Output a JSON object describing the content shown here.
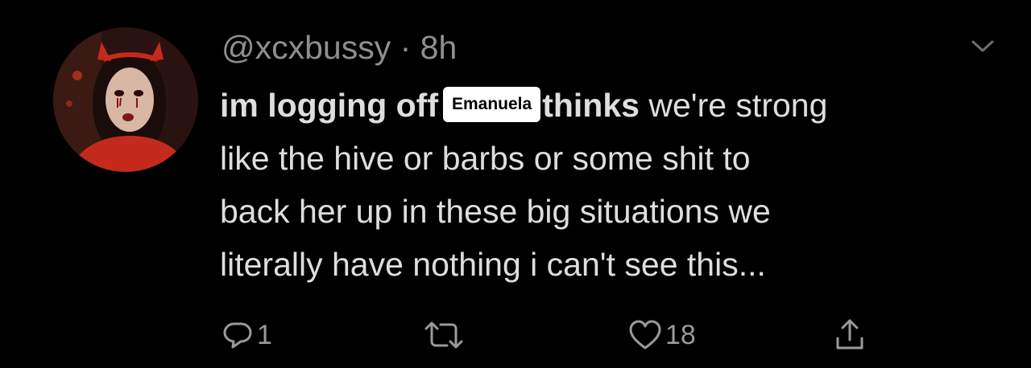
{
  "tweet": {
    "handle": "@xcxbussy",
    "separator": " · ",
    "time": "8h",
    "text_bold_start": "im logging off",
    "tag_label": "Emanuela",
    "text_bold_mid": "thinks",
    "text_line1_rest": " we're strong",
    "text_line2": "like the hive or barbs or some shit to",
    "text_line3": "back her up in these big situations we",
    "text_line4": "literally have nothing i can't see this..."
  },
  "actions": {
    "reply_count": "1",
    "retweet_count": "",
    "like_count": "18"
  },
  "icons": {
    "chevron": "chevron-down-icon",
    "reply": "reply-icon",
    "retweet": "retweet-icon",
    "like": "heart-icon",
    "share": "share-icon"
  },
  "colors": {
    "background": "#000000",
    "text": "#dedede",
    "secondary": "#8f8f8f",
    "tag_bg": "#ffffff",
    "avatar_red": "#c42a1c"
  }
}
